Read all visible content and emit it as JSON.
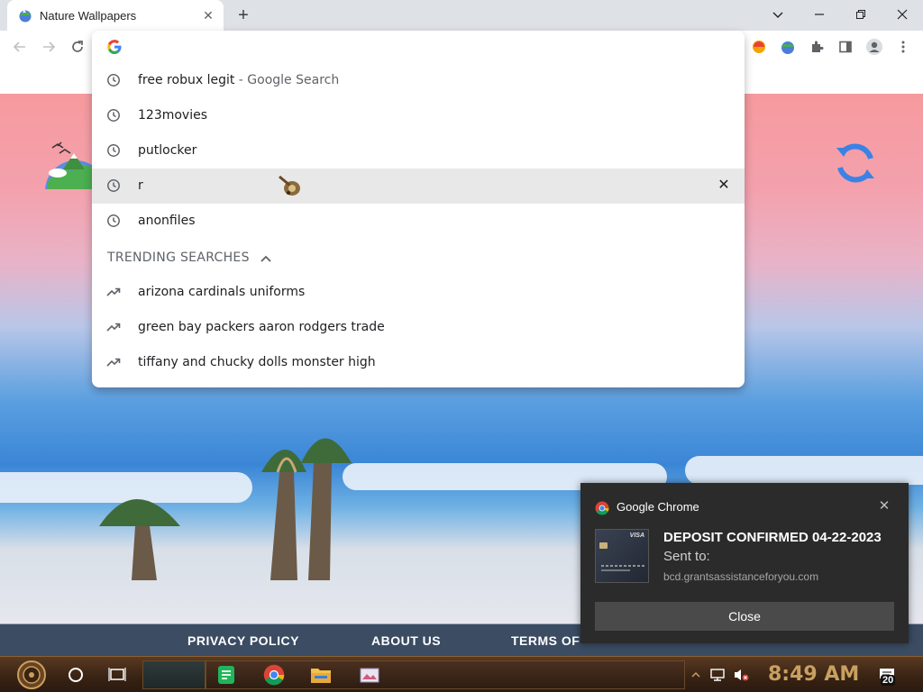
{
  "tab": {
    "title": "Nature Wallpapers",
    "close": "✕",
    "new_tab": "+"
  },
  "window_controls": {
    "minimize": "minimize",
    "restore": "restore",
    "close": "close"
  },
  "omnibox": {
    "input_value": "",
    "suggestions": [
      {
        "icon": "clock-icon",
        "text": "free robux legit",
        "suffix": " - Google Search"
      },
      {
        "icon": "clock-icon",
        "text": "123movies",
        "suffix": ""
      },
      {
        "icon": "clock-icon",
        "text": "putlocker",
        "suffix": ""
      },
      {
        "icon": "clock-icon",
        "text": "r",
        "suffix": "",
        "selected": true,
        "remove": "✕"
      },
      {
        "icon": "clock-icon",
        "text": "anonfiles",
        "suffix": ""
      }
    ],
    "trending_header": "TRENDING SEARCHES",
    "trending": [
      {
        "icon": "trending-icon",
        "text": "arizona cardinals uniforms"
      },
      {
        "icon": "trending-icon",
        "text": "green bay packers aaron rodgers trade"
      },
      {
        "icon": "trending-icon",
        "text": "tiffany and chucky dolls monster high"
      }
    ]
  },
  "footer": {
    "links": [
      "PRIVACY POLICY",
      "ABOUT US",
      "TERMS OF"
    ]
  },
  "notification": {
    "app": "Google Chrome",
    "close": "✕",
    "title": "DEPOSIT CONFIRMED 04-22-2023",
    "body": "Sent to:",
    "attribution": "bcd.grantsassistanceforyou.com",
    "button": "Close",
    "image_label": "VISA"
  },
  "taskbar": {
    "time": "8:49 AM",
    "notification_count": "20"
  },
  "colors": {
    "accent_blue": "#1a73e8",
    "notification_bg": "#2b2b2b",
    "footer_bg": "#3b4c63",
    "clock": "#c8a060"
  }
}
